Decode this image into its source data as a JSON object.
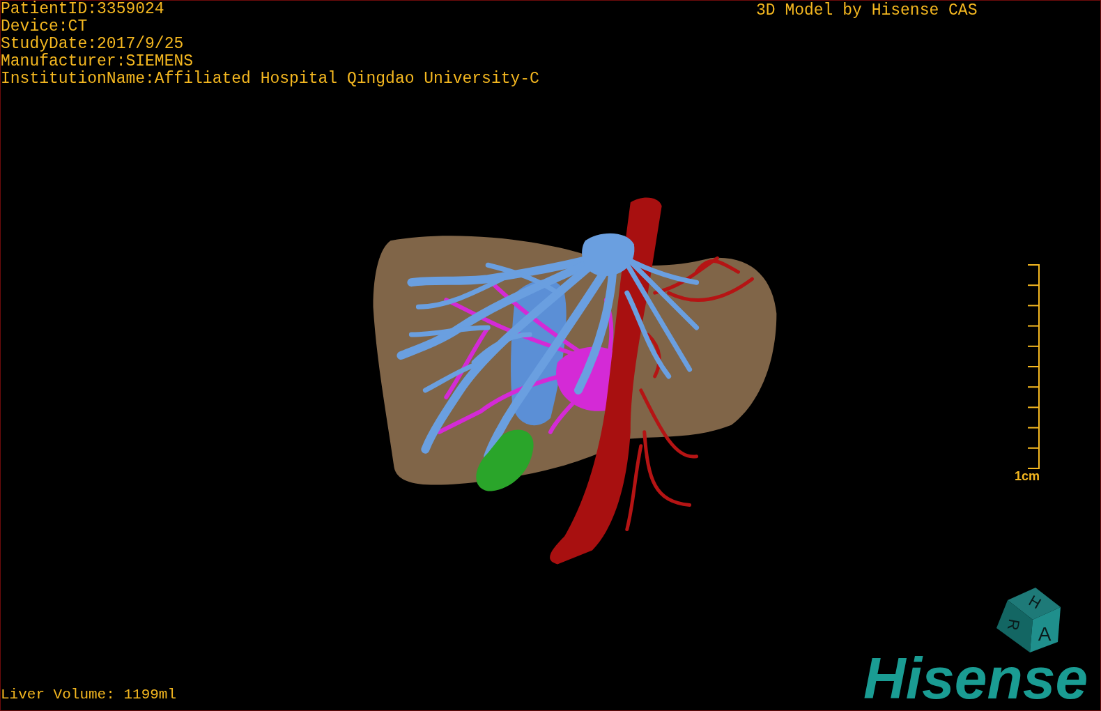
{
  "info_lines": [
    "PatientID:3359024",
    "Device:CT",
    "StudyDate:2017/9/25",
    "Manufacturer:SIEMENS",
    "InstitutionName:Affiliated Hospital Qingdao University-C"
  ],
  "title": "3D Model by Hisense CAS",
  "scale_bar": {
    "label": "1cm"
  },
  "orientation_cube": {
    "labels": [
      "H",
      "R",
      "A"
    ]
  },
  "logo": "Hisense",
  "liver_volume": "Liver Volume: 1199ml"
}
